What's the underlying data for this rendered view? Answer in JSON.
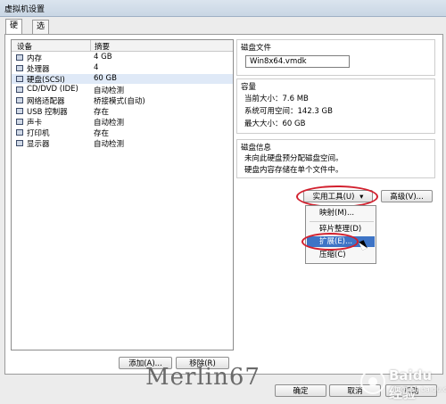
{
  "window": {
    "title": "虚拟机设置"
  },
  "tabs": [
    {
      "label": "硬件"
    },
    {
      "label": "选项"
    }
  ],
  "devices": {
    "headers": {
      "device": "设备",
      "summary": "摘要"
    },
    "rows": [
      {
        "name": "内存",
        "value": "4 GB",
        "icon": "memory-icon"
      },
      {
        "name": "处理器",
        "value": "4",
        "icon": "cpu-icon"
      },
      {
        "name": "硬盘(SCSI)",
        "value": "60 GB",
        "icon": "harddisk-icon",
        "selected": true
      },
      {
        "name": "CD/DVD (IDE)",
        "value": "自动检测",
        "icon": "cdrom-icon"
      },
      {
        "name": "网络适配器",
        "value": "桥接模式(自动)",
        "icon": "network-icon"
      },
      {
        "name": "USB 控制器",
        "value": "存在",
        "icon": "usb-icon"
      },
      {
        "name": "声卡",
        "value": "自动检测",
        "icon": "sound-icon"
      },
      {
        "name": "打印机",
        "value": "存在",
        "icon": "printer-icon"
      },
      {
        "name": "显示器",
        "value": "自动检测",
        "icon": "display-icon"
      }
    ]
  },
  "disk_file": {
    "title": "磁盘文件",
    "value": "Win8x64.vmdk"
  },
  "capacity": {
    "title": "容量",
    "current": "当前大小：7.6 MB",
    "available": "系统可用空间：142.3 GB",
    "max": "最大大小：60 GB"
  },
  "disk_info": {
    "title": "磁盘信息",
    "line1": "未向此硬盘预分配磁盘空间。",
    "line2": "硬盘内容存储在单个文件中。"
  },
  "buttons": {
    "utilities": "实用工具(U)",
    "advanced": "高级(V)...",
    "add": "添加(A)...",
    "remove": "移除(R)",
    "ok": "确定",
    "cancel": "取消",
    "help": "帮助"
  },
  "menu": {
    "items": [
      {
        "label": "映射(M)..."
      },
      {
        "label": "碎片整理(D)"
      },
      {
        "label": "扩展(E)...",
        "highlighted": true
      },
      {
        "label": "压缩(C)"
      }
    ]
  },
  "watermark": {
    "text": "Merlin67",
    "brand": "Baidu 经验",
    "url": "jingyan.baidu.com"
  },
  "colors": {
    "highlight": "#3e74c6",
    "annotation_ring": "#d2202e",
    "selected_row": "#dfe9f7"
  }
}
